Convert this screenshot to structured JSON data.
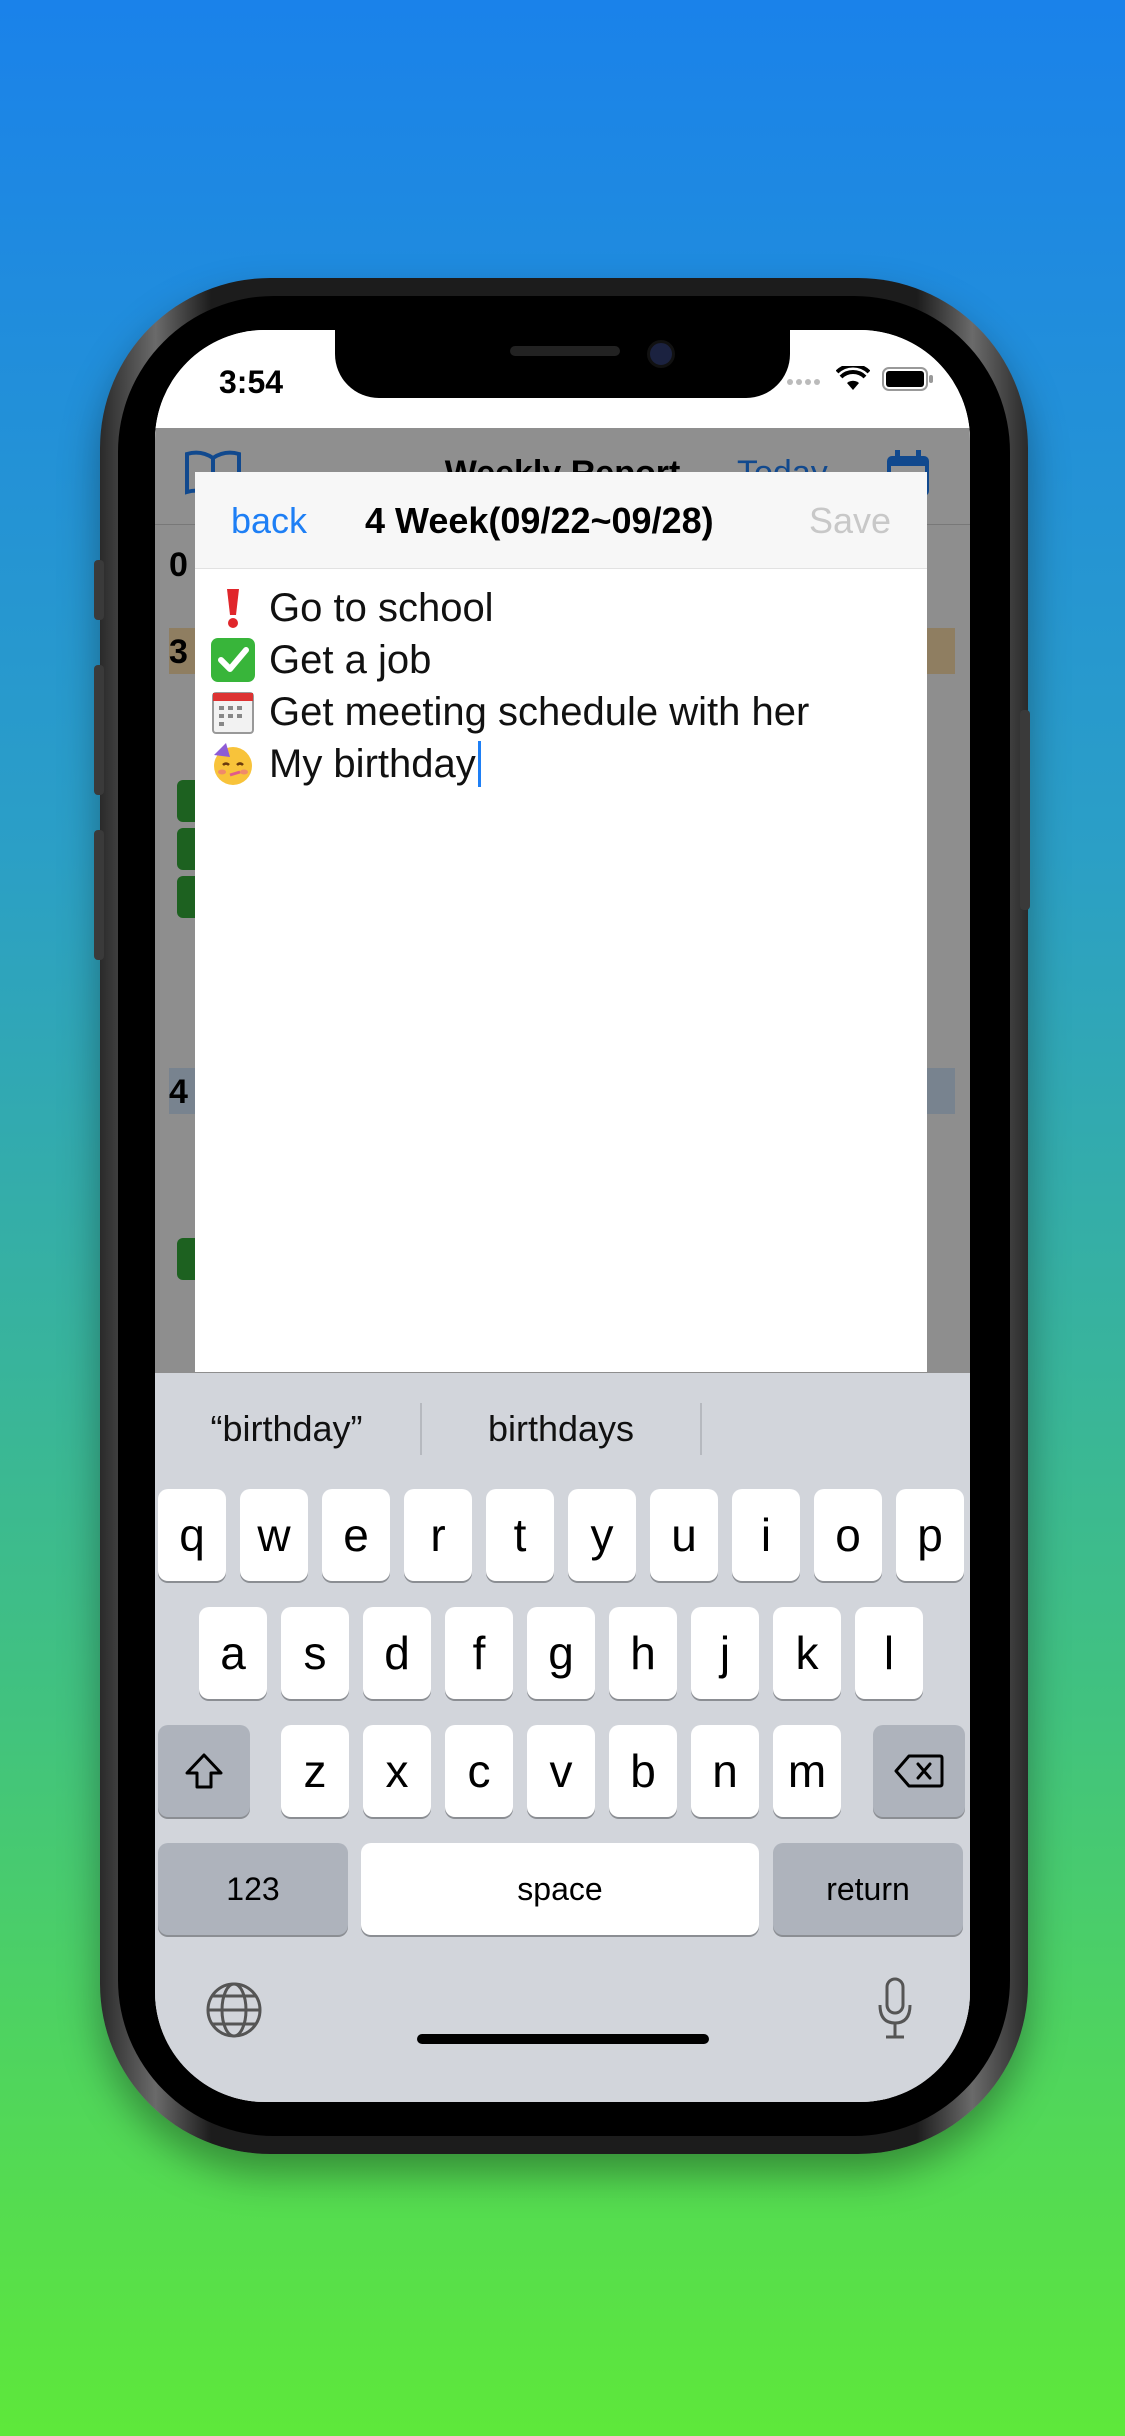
{
  "status": {
    "time": "3:54"
  },
  "background_app": {
    "title": "Weekly Report",
    "today_label": "Today",
    "rows": [
      "0",
      "3",
      "4"
    ]
  },
  "modal": {
    "back_label": "back",
    "title": "4 Week(09/22~09/28)",
    "save_label": "Save",
    "lines": [
      {
        "icon": "exclamation-icon",
        "text": "Go to school"
      },
      {
        "icon": "check-icon",
        "text": "Get a job"
      },
      {
        "icon": "calendar-icon",
        "text": "Get meeting schedule with her"
      },
      {
        "icon": "party-face-icon",
        "text": "My birthday"
      }
    ]
  },
  "keyboard": {
    "suggestions": [
      "“birthday”",
      "birthdays",
      ""
    ],
    "row1": [
      "q",
      "w",
      "e",
      "r",
      "t",
      "y",
      "u",
      "i",
      "o",
      "p"
    ],
    "row2": [
      "a",
      "s",
      "d",
      "f",
      "g",
      "h",
      "j",
      "k",
      "l"
    ],
    "row3": [
      "z",
      "x",
      "c",
      "v",
      "b",
      "n",
      "m"
    ],
    "numbers_label": "123",
    "space_label": "space",
    "return_label": "return"
  },
  "colors": {
    "accent": "#1e7ff5",
    "save_disabled": "#c8c8c8",
    "keyboard_bg": "#d2d5db"
  }
}
